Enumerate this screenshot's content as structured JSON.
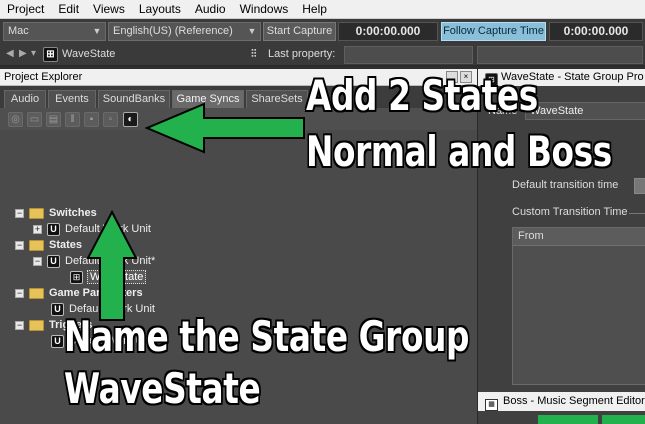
{
  "menu": [
    "Project",
    "Edit",
    "Views",
    "Layouts",
    "Audio",
    "Windows",
    "Help"
  ],
  "toolbar": {
    "platform": "Mac",
    "language": "English(US) (Reference)",
    "start_capture": "Start Capture",
    "time_left": "0:00:00.000",
    "follow_capture": "Follow Capture Time",
    "time_right": "0:00:00.000",
    "object_name": "WaveState",
    "last_property_label": "Last property:"
  },
  "explorer": {
    "title": "Project Explorer",
    "tabs": [
      "Audio",
      "Events",
      "SoundBanks",
      "Game Syncs",
      "ShareSets"
    ],
    "active_tab": "Game Syncs",
    "tree": {
      "switches": "Switches",
      "switches_wu": "Default Work Unit",
      "states": "States",
      "states_wu": "Default Work Unit*",
      "wavestate": "WaveState",
      "game_parameters": "Game Parameters",
      "gp_wu": "Default Work Unit",
      "triggers": "Triggers",
      "triggers_wu": "Default Work Unit"
    }
  },
  "editor": {
    "title": "WaveState - State Group Pro",
    "name_label": "Name",
    "name_value": "WaveState",
    "default_transition": "Default transition time",
    "custom_transition": "Custom Transition Time",
    "from_header": "From",
    "bottom_title": "Boss - Music Segment Editor -"
  },
  "annotations": {
    "top_line1": "Add 2 States",
    "top_line2": "Normal and Boss",
    "bottom_line1": "Name the State Group",
    "bottom_line2": "WaveState"
  },
  "colors": {
    "arrow": "#22b14c",
    "follow_capture": "#89bfd9"
  }
}
